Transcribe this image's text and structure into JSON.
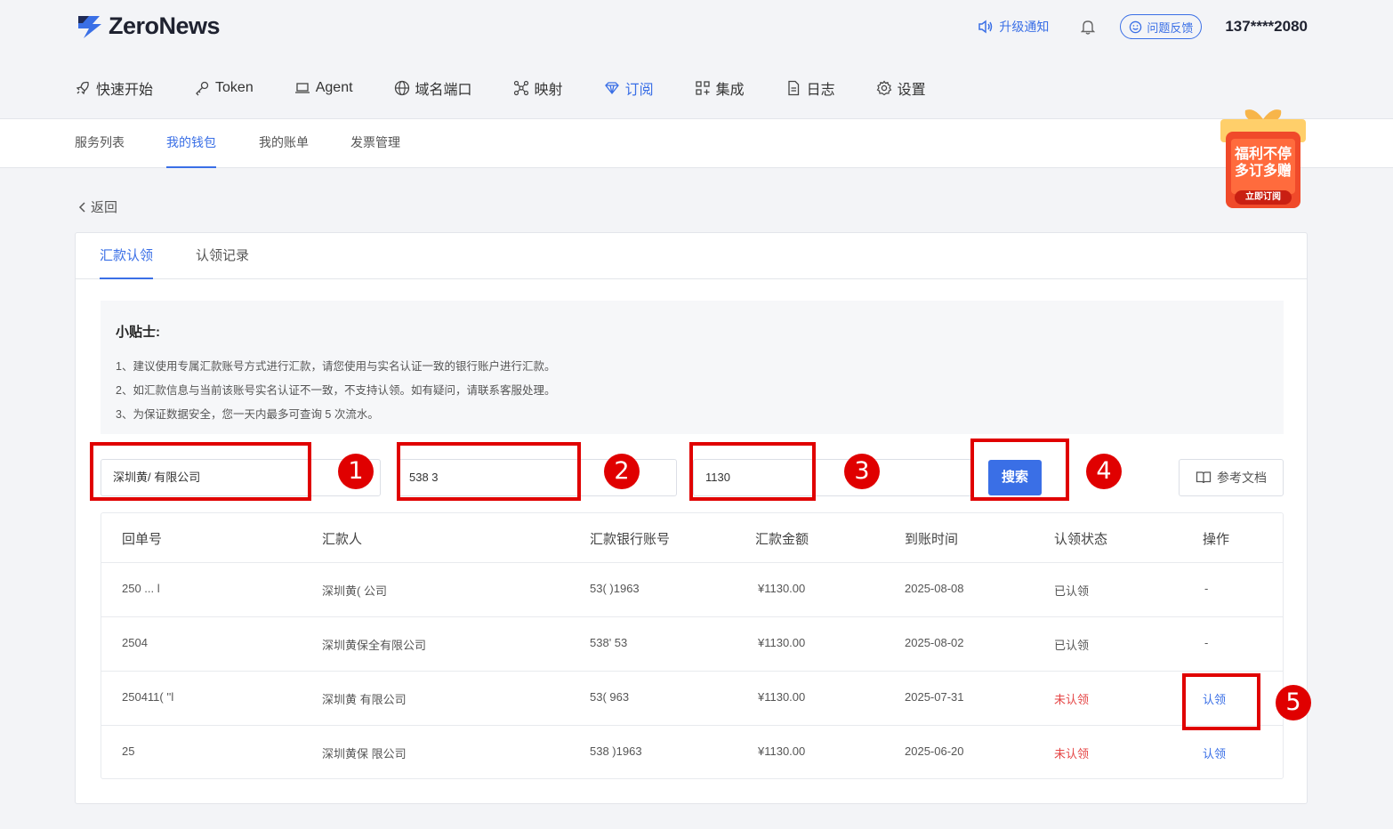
{
  "header": {
    "logo_text": "ZeroNews",
    "notice_label": "升级通知",
    "feedback_label": "问题反馈",
    "user_phone": "137****2080"
  },
  "main_nav": {
    "items": [
      {
        "label": "快速开始",
        "icon": "rocket-icon"
      },
      {
        "label": "Token",
        "icon": "key-icon"
      },
      {
        "label": "Agent",
        "icon": "laptop-icon"
      },
      {
        "label": "域名端口",
        "icon": "globe-icon"
      },
      {
        "label": "映射",
        "icon": "network-icon"
      },
      {
        "label": "订阅",
        "icon": "diamond-icon",
        "active": true
      },
      {
        "label": "集成",
        "icon": "grid-icon"
      },
      {
        "label": "日志",
        "icon": "document-icon"
      },
      {
        "label": "设置",
        "icon": "gear-icon"
      }
    ]
  },
  "sub_nav": {
    "tabs": [
      "服务列表",
      "我的钱包",
      "我的账单",
      "发票管理"
    ],
    "active": "我的钱包"
  },
  "promo": {
    "line1": "福利不停",
    "line2": "多订多赠",
    "button": "立即订阅"
  },
  "back_label": "返回",
  "card": {
    "tabs": [
      "汇款认领",
      "认领记录"
    ],
    "active_tab": "汇款认领"
  },
  "tips": {
    "title": "小贴士:",
    "lines": [
      "1、建议使用专属汇款账号方式进行汇款，请您使用与实名认证一致的银行账户进行汇款。",
      "2、如汇款信息与当前该账号实名认证不一致，不支持认领。如有疑问，请联系客服处理。",
      "3、为保证数据安全，您一天内最多可查询 5 次流水。"
    ]
  },
  "search_form": {
    "remitter_value": "深圳黄/  有限公司",
    "account_value": "538           3",
    "amount_value": "1130",
    "search_label": "搜索",
    "doc_label": "参考文档"
  },
  "table": {
    "columns": [
      "回单号",
      "汇款人",
      "汇款银行账号",
      "汇款金额",
      "到账时间",
      "认领状态",
      "操作"
    ],
    "rows": [
      {
        "receipt": "250 ...                 l",
        "remitter": "深圳黄(            公司",
        "account": "53(           )1963",
        "amount": "¥1130.00",
        "date": "2025-08-08",
        "status": "已认领",
        "claimed": true,
        "op": "-"
      },
      {
        "receipt": "2504                    ",
        "remitter": "深圳黄保全有限公司",
        "account": "538'            53",
        "amount": "¥1130.00",
        "date": "2025-08-02",
        "status": "已认领",
        "claimed": true,
        "op": "-"
      },
      {
        "receipt": "250411(                 ''l",
        "remitter": "深圳黄    有限公司",
        "account": "53(           963",
        "amount": "¥1130.00",
        "date": "2025-07-31",
        "status": "未认领",
        "claimed": false,
        "op": "认领"
      },
      {
        "receipt": "25",
        "remitter": "深圳黄保    限公司",
        "account": "538           )1963",
        "amount": "¥1130.00",
        "date": "2025-06-20",
        "status": "未认领",
        "claimed": false,
        "op": "认领"
      }
    ]
  },
  "annotations": [
    "1",
    "2",
    "3",
    "4",
    "5"
  ],
  "colors": {
    "accent": "#3a6fe6",
    "annotation": "#e00000",
    "unclaimed": "#e54545"
  }
}
